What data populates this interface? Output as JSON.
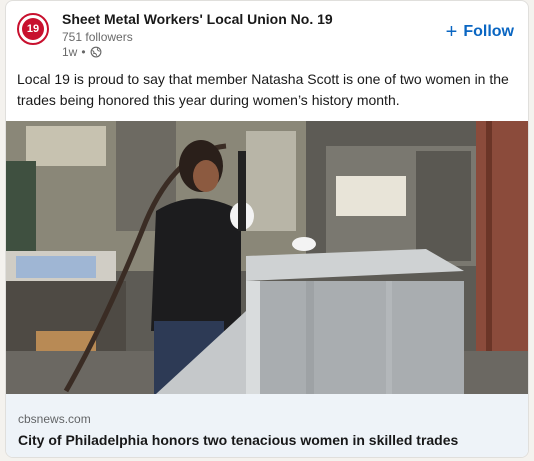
{
  "post": {
    "org_name": "Sheet Metal Workers' Local Union No. 19",
    "logo_text": "19",
    "followers": "751 followers",
    "time": "1w",
    "follow_label": "Follow",
    "text": "Local 19 is proud to say that member Natasha Scott is one of two women in the trades being honored this year during women’s history month."
  },
  "link": {
    "source": "cbsnews.com",
    "headline": "City of Philadelphia honors two tenacious women in skilled trades"
  },
  "colors": {
    "accent": "#0a66c2",
    "logo_red": "#c8102e",
    "link_bg": "#eef3f8"
  },
  "icons": [
    "globe-icon",
    "plus-icon"
  ]
}
